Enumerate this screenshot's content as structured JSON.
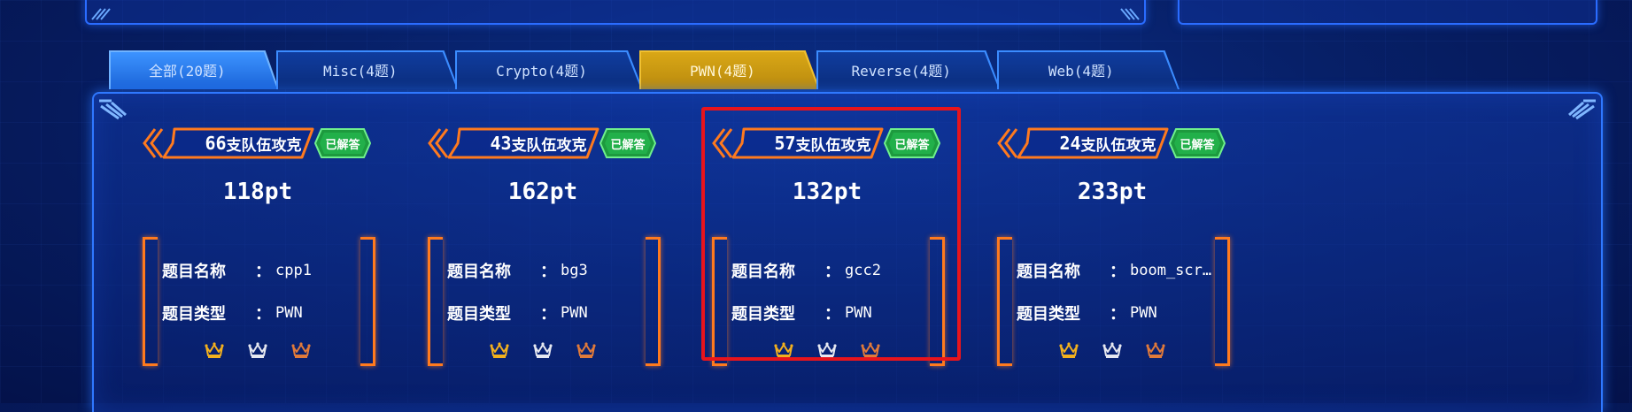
{
  "tabs": [
    {
      "label": "全部(20题)",
      "state": "all"
    },
    {
      "label": "Misc(4题)",
      "state": "normal"
    },
    {
      "label": "Crypto(4题)",
      "state": "normal"
    },
    {
      "label": "PWN(4题)",
      "state": "active"
    },
    {
      "label": "Reverse(4题)",
      "state": "normal"
    },
    {
      "label": "Web(4题)",
      "state": "normal"
    }
  ],
  "labels": {
    "solver_suffix": "支队伍攻克",
    "solved_badge": "已解答",
    "name_label": "题目名称",
    "type_label": "题目类型",
    "separator": "："
  },
  "challenges": [
    {
      "solvers": "66",
      "points": "118pt",
      "name": "cpp1",
      "type": "PWN",
      "solved": true
    },
    {
      "solvers": "43",
      "points": "162pt",
      "name": "bg3",
      "type": "PWN",
      "solved": true
    },
    {
      "solvers": "57",
      "points": "132pt",
      "name": "gcc2",
      "type": "PWN",
      "solved": true
    },
    {
      "solvers": "24",
      "points": "233pt",
      "name": "boom_scr…",
      "type": "PWN",
      "solved": true
    }
  ],
  "icons": [
    "gold-crown-icon",
    "silver-crown-icon",
    "bronze-crown-icon"
  ],
  "colors": {
    "accent_orange": "#ff7a1e",
    "badge_green": "#22b04a",
    "active_tab": "#d9a716",
    "highlight_red": "#e8141c",
    "gold": "#f2b01e",
    "silver": "#e6e8f0",
    "bronze": "#e07a3a"
  }
}
